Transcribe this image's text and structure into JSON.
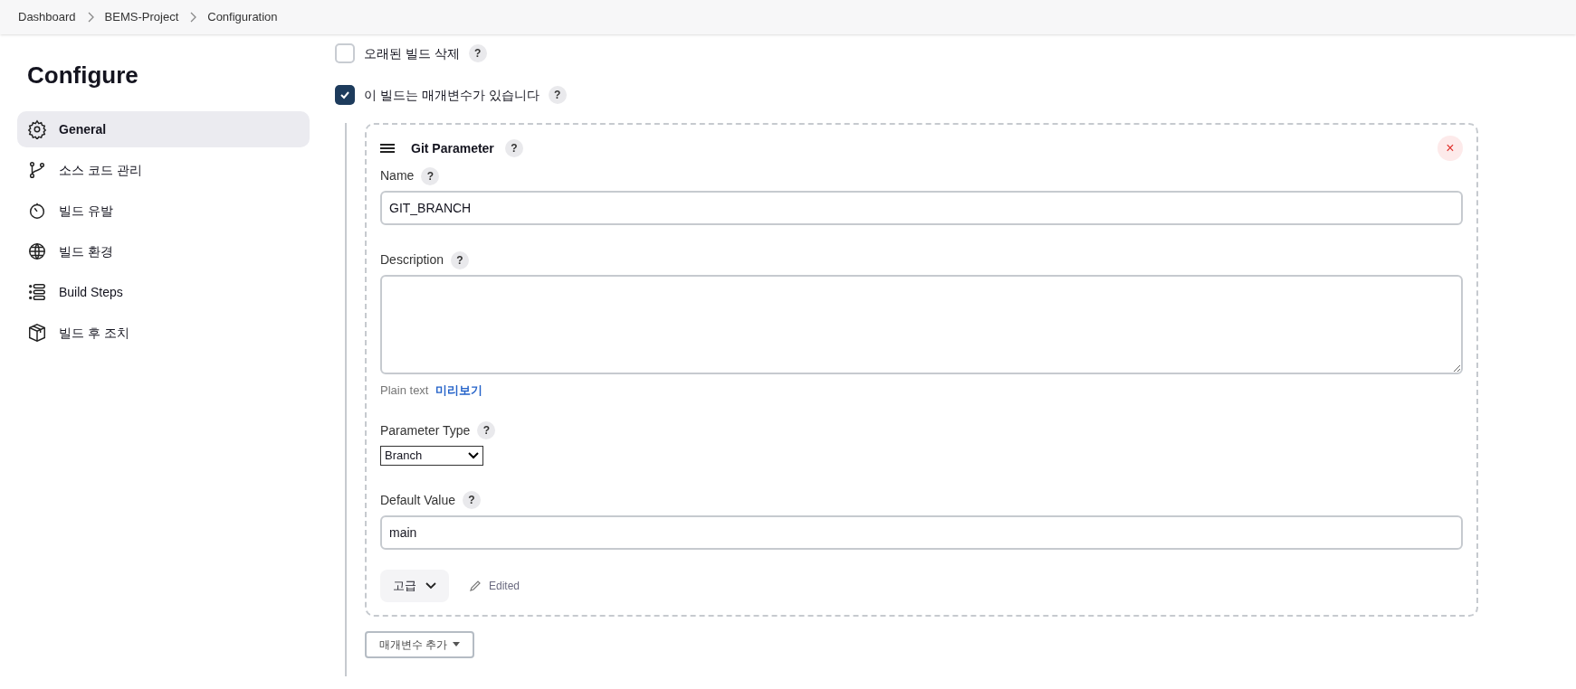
{
  "breadcrumbs": [
    "Dashboard",
    "BEMS-Project",
    "Configuration"
  ],
  "sidebar": {
    "title": "Configure",
    "items": [
      {
        "label": "General",
        "selected": true
      },
      {
        "label": "소스 코드 관리",
        "selected": false
      },
      {
        "label": "빌드 유발",
        "selected": false
      },
      {
        "label": "빌드 환경",
        "selected": false
      },
      {
        "label": "Build Steps",
        "selected": false
      },
      {
        "label": "빌드 후 조치",
        "selected": false
      }
    ]
  },
  "options": [
    {
      "label": "오래된 빌드 삭제",
      "help": "?",
      "checked": false
    },
    {
      "label": "이 빌드는 매개변수가 있습니다",
      "help": "?",
      "checked": true
    }
  ],
  "parameter": {
    "title": "Git Parameter",
    "help": "?",
    "close": "×",
    "fields": [
      {
        "kind": "text",
        "label": "Name",
        "help": "?",
        "value": "GIT_BRANCH"
      },
      {
        "kind": "textarea",
        "label": "Description",
        "help": "?",
        "format": "Plain text",
        "preview": "미리보기"
      },
      {
        "kind": "select",
        "label": "Parameter Type",
        "help": "?",
        "value": "Branch"
      },
      {
        "kind": "text",
        "label": "Default Value",
        "help": "?",
        "value": "main"
      }
    ],
    "advanced": "고급",
    "edited": "Edited"
  },
  "add_button": "매개변수 추가"
}
